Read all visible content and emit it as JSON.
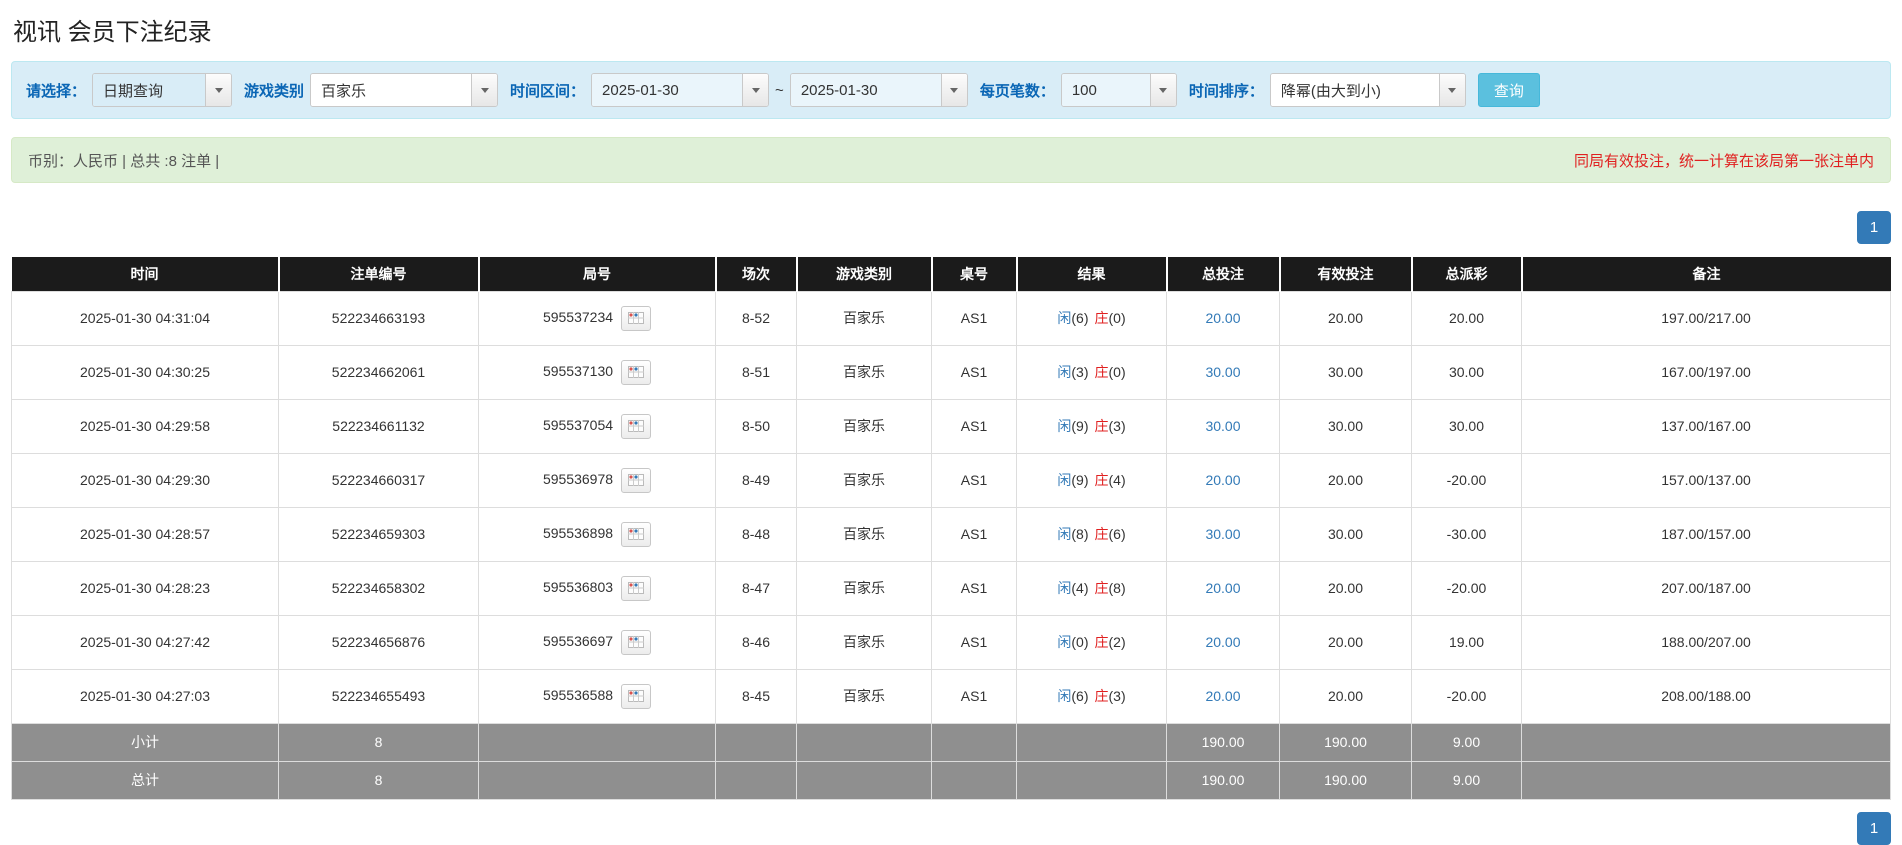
{
  "page": {
    "title": "视讯 会员下注纪录"
  },
  "filters": {
    "select_label": "请选择：",
    "query_type_value": "日期查询",
    "game_type_label": "游戏类别",
    "game_type_value": "百家乐",
    "date_range_label": "时间区间：",
    "date_from_value": "2025-01-30",
    "date_separator": "~",
    "date_to_value": "2025-01-30",
    "page_size_label": "每页笔数：",
    "page_size_value": "100",
    "sort_label": "时间排序：",
    "sort_value": "降幂(由大到小)",
    "search_button_label": "查询"
  },
  "summary": {
    "left": "币别：人民币 | 总共 :8 注单 |",
    "right": "同局有效投注，统一计算在该局第一张注单内"
  },
  "pagination": {
    "current_page": "1"
  },
  "table": {
    "headers": [
      "时间",
      "注单编号",
      "局号",
      "场次",
      "游戏类别",
      "桌号",
      "结果",
      "总投注",
      "有效投注",
      "总派彩",
      "备注"
    ],
    "rows": [
      {
        "time": "2025-01-30 04:31:04",
        "bet_id": "522234663193",
        "round_id": "595537234",
        "session": "8-52",
        "game": "百家乐",
        "table": "AS1",
        "player_label": "闲",
        "player_score": "(6)",
        "banker_label": "庄",
        "banker_score": "(0)",
        "total_bet": "20.00",
        "valid_bet": "20.00",
        "payout": "20.00",
        "remark": "197.00/217.00"
      },
      {
        "time": "2025-01-30 04:30:25",
        "bet_id": "522234662061",
        "round_id": "595537130",
        "session": "8-51",
        "game": "百家乐",
        "table": "AS1",
        "player_label": "闲",
        "player_score": "(3)",
        "banker_label": "庄",
        "banker_score": "(0)",
        "total_bet": "30.00",
        "valid_bet": "30.00",
        "payout": "30.00",
        "remark": "167.00/197.00"
      },
      {
        "time": "2025-01-30 04:29:58",
        "bet_id": "522234661132",
        "round_id": "595537054",
        "session": "8-50",
        "game": "百家乐",
        "table": "AS1",
        "player_label": "闲",
        "player_score": "(9)",
        "banker_label": "庄",
        "banker_score": "(3)",
        "total_bet": "30.00",
        "valid_bet": "30.00",
        "payout": "30.00",
        "remark": "137.00/167.00"
      },
      {
        "time": "2025-01-30 04:29:30",
        "bet_id": "522234660317",
        "round_id": "595536978",
        "session": "8-49",
        "game": "百家乐",
        "table": "AS1",
        "player_label": "闲",
        "player_score": "(9)",
        "banker_label": "庄",
        "banker_score": "(4)",
        "total_bet": "20.00",
        "valid_bet": "20.00",
        "payout": "-20.00",
        "remark": "157.00/137.00"
      },
      {
        "time": "2025-01-30 04:28:57",
        "bet_id": "522234659303",
        "round_id": "595536898",
        "session": "8-48",
        "game": "百家乐",
        "table": "AS1",
        "player_label": "闲",
        "player_score": "(8)",
        "banker_label": "庄",
        "banker_score": "(6)",
        "total_bet": "30.00",
        "valid_bet": "30.00",
        "payout": "-30.00",
        "remark": "187.00/157.00"
      },
      {
        "time": "2025-01-30 04:28:23",
        "bet_id": "522234658302",
        "round_id": "595536803",
        "session": "8-47",
        "game": "百家乐",
        "table": "AS1",
        "player_label": "闲",
        "player_score": "(4)",
        "banker_label": "庄",
        "banker_score": "(8)",
        "total_bet": "20.00",
        "valid_bet": "20.00",
        "payout": "-20.00",
        "remark": "207.00/187.00"
      },
      {
        "time": "2025-01-30 04:27:42",
        "bet_id": "522234656876",
        "round_id": "595536697",
        "session": "8-46",
        "game": "百家乐",
        "table": "AS1",
        "player_label": "闲",
        "player_score": "(0)",
        "banker_label": "庄",
        "banker_score": "(2)",
        "total_bet": "20.00",
        "valid_bet": "20.00",
        "payout": "19.00",
        "remark": "188.00/207.00"
      },
      {
        "time": "2025-01-30 04:27:03",
        "bet_id": "522234655493",
        "round_id": "595536588",
        "session": "8-45",
        "game": "百家乐",
        "table": "AS1",
        "player_label": "闲",
        "player_score": "(6)",
        "banker_label": "庄",
        "banker_score": "(3)",
        "total_bet": "20.00",
        "valid_bet": "20.00",
        "payout": "-20.00",
        "remark": "208.00/188.00"
      }
    ],
    "subtotal": {
      "label": "小计",
      "count": "8",
      "total_bet": "190.00",
      "valid_bet": "190.00",
      "payout": "9.00"
    },
    "total": {
      "label": "总计",
      "count": "8",
      "total_bet": "190.00",
      "valid_bet": "190.00",
      "payout": "9.00"
    }
  }
}
